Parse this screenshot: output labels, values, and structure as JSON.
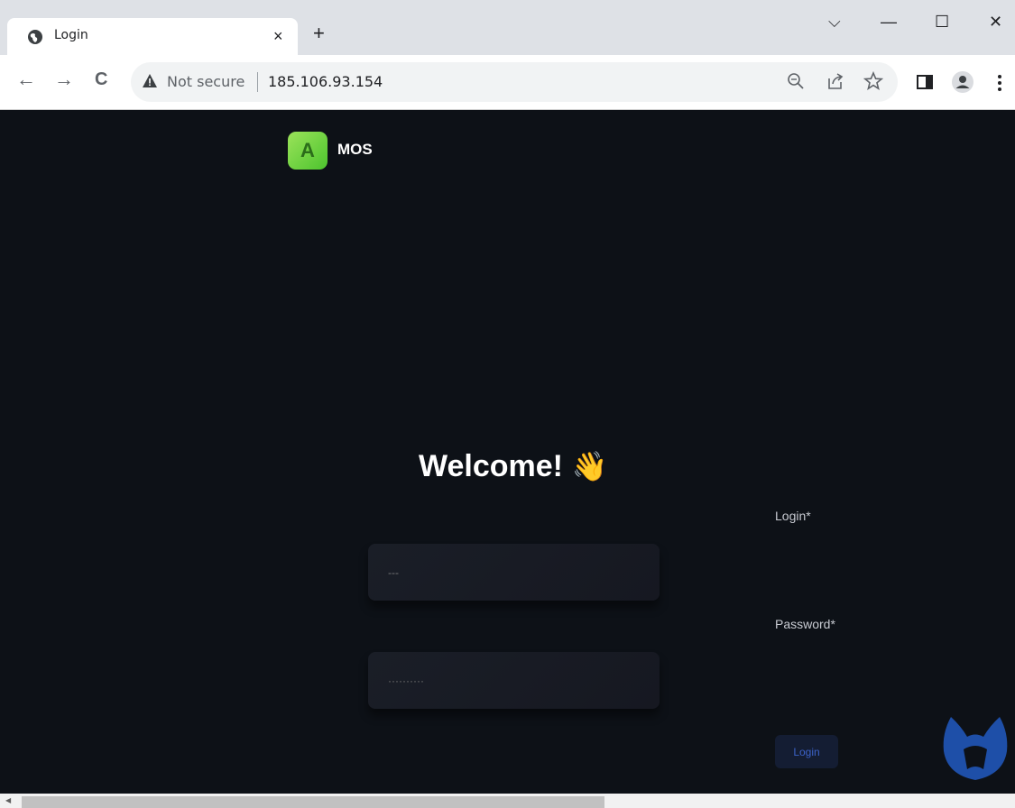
{
  "browser": {
    "tab_title": "Login",
    "tab_close": "×",
    "new_tab": "+",
    "window_controls": {
      "dropdown": "⌵",
      "minimize": "—",
      "maximize": "☐",
      "close": "✕"
    },
    "nav": {
      "back": "←",
      "forward": "→",
      "reload": "C"
    },
    "security_label": "Not secure",
    "url": "185.106.93.154",
    "icons": [
      "globe-icon",
      "warning-icon",
      "zoom-icon",
      "share-icon",
      "star-icon",
      "side-panel-icon",
      "profile-icon",
      "menu-icon"
    ]
  },
  "page": {
    "logo_letter": "A",
    "logo_text": "MOS",
    "welcome_text": "Welcome!",
    "welcome_emoji": "👋",
    "login_label": "Login*",
    "login_placeholder": "---",
    "password_label": "Password*",
    "password_placeholder": "··········",
    "login_button": "Login"
  },
  "colors": {
    "page_bg": "#0d1117",
    "logo_green": "#6fd23b",
    "button_text": "#3c62c8",
    "malwarebytes_blue": "#1e4fa8"
  }
}
